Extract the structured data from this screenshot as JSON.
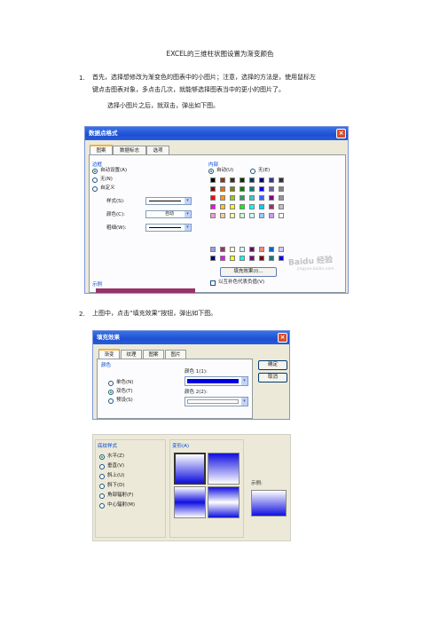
{
  "doc": {
    "title": "EXCEL的三维柱状图设置为渐变颜色",
    "step1_num": "1.",
    "step1_line1": "首先，选择想修改为渐变色的图表中的小图片；注意，选择的方法是，使用鼠标左",
    "step1_line2": "键点击图表对象，多点击几次，就能够选择图表当中的更小的图片了。",
    "step1_line3": "选择小图片之后，就双击，弹出如下图。",
    "step2_num": "2.",
    "step2_line1": "上图中，点击“填充效果”按钮，弹出如下图。"
  },
  "dialog1": {
    "title": "数据点格式",
    "close": "×",
    "tabs": [
      "图案",
      "数据标志",
      "选项"
    ],
    "border_group": "边框",
    "border_options": [
      "自动设置(A)",
      "无(N)",
      "自定义"
    ],
    "style_label": "样式(S):",
    "color_label": "颜色(C):",
    "color_value": "自动",
    "weight_label": "粗细(W):",
    "fill_group": "内部",
    "fill_auto": "自动(U)",
    "fill_none": "无(E)",
    "fill_effects_button": "填充效果(I)...",
    "invert_if_negative": "以互补色代表负值(V)",
    "sample_label": "示例",
    "palette": [
      "#000000",
      "#993300",
      "#333300",
      "#003300",
      "#003366",
      "#000080",
      "#333399",
      "#333333",
      "#800000",
      "#ff6600",
      "#808000",
      "#008000",
      "#008080",
      "#0000ff",
      "#666699",
      "#808080",
      "#ff0000",
      "#ff9900",
      "#99cc00",
      "#339966",
      "#33cccc",
      "#3366ff",
      "#800080",
      "#969696",
      "#ff00ff",
      "#ffcc00",
      "#ffff00",
      "#00ff00",
      "#00ffff",
      "#00ccff",
      "#993366",
      "#c0c0c0",
      "#ff99cc",
      "#ffcc99",
      "#ffff99",
      "#ccffcc",
      "#ccffff",
      "#99ccff",
      "#cc99ff",
      "#ffffff"
    ],
    "palette2": [
      "#9999ff",
      "#993366",
      "#ffffcc",
      "#ccffff",
      "#660066",
      "#ff8080",
      "#0066cc",
      "#ccccff",
      "#000080",
      "#ff00ff",
      "#ffff00",
      "#00ffff",
      "#800080",
      "#800000",
      "#008080",
      "#0000ff"
    ],
    "sample_color": "#993366",
    "watermark": "Baidu 经验",
    "watermark_url": "jingyan.baidu.com"
  },
  "dialog2": {
    "title": "填充效果",
    "close": "×",
    "tabs": [
      "渐变",
      "纹理",
      "图案",
      "图片"
    ],
    "color_group": "颜色",
    "color_options": [
      "单色(N)",
      "双色(T)",
      "预设(S)"
    ],
    "color1_label": "颜色 1(1):",
    "color2_label": "颜色 2(2):",
    "color1": "#0000e0",
    "ok": "确定",
    "cancel": "取消"
  },
  "dialog3": {
    "shading_group": "底纹样式",
    "shading_options": [
      "水平(Z)",
      "垂直(V)",
      "斜上(U)",
      "斜下(D)",
      "角部辐射(F)",
      "中心辐射(M)"
    ],
    "variants_group": "变形(A)",
    "sample_label": "示例:",
    "color_dark": "#1010e0",
    "color_light": "#ffffff"
  }
}
